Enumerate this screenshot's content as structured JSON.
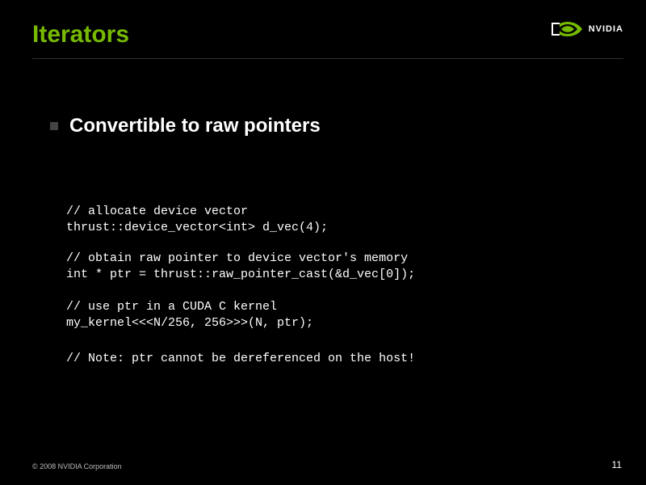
{
  "title": "Iterators",
  "logo_text": "NVIDIA",
  "subtitle": "Convertible to raw pointers",
  "code1_comment": "// allocate device vector",
  "code1_line": "thrust::device_vector<int> d_vec(4);",
  "code2_comment": "// obtain raw pointer to device vector's memory",
  "code2_line": "int * ptr = thrust::raw_pointer_cast(&d_vec[0]);",
  "code3_comment": "// use ptr in a CUDA C kernel",
  "code3_line": "my_kernel<<<N/256, 256>>>(N, ptr);",
  "code4_comment": "// Note: ptr cannot be dereferenced on the host!",
  "copyright": "© 2008 NVIDIA Corporation",
  "page_number": "11"
}
